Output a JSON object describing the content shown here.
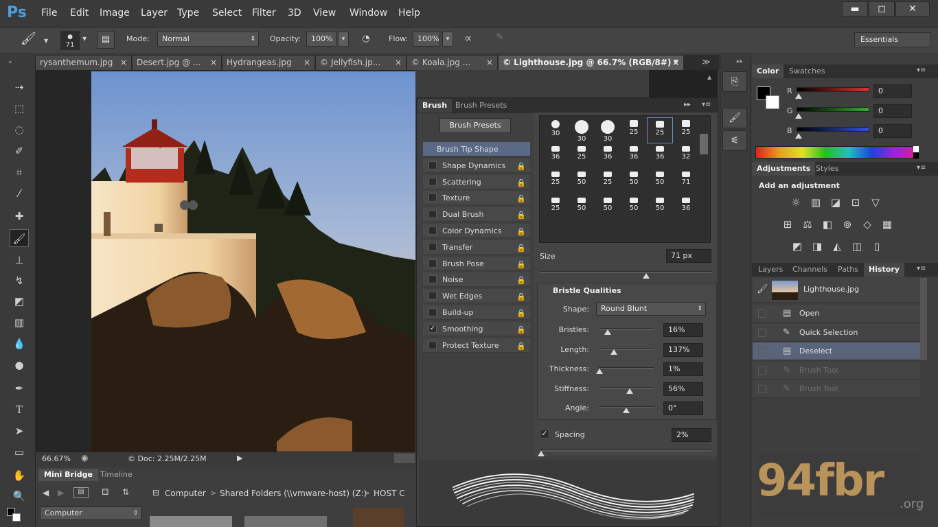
{
  "app": {
    "logo": "Ps"
  },
  "menu": [
    "File",
    "Edit",
    "Image",
    "Layer",
    "Type",
    "Select",
    "Filter",
    "3D",
    "View",
    "Window",
    "Help"
  ],
  "window_controls": {
    "minimize": "▬",
    "maximize": "◻",
    "close": "✕"
  },
  "options_bar": {
    "brush_size": "71",
    "mode_label": "Mode:",
    "mode_value": "Normal",
    "opacity_label": "Opacity:",
    "opacity_value": "100%",
    "flow_label": "Flow:",
    "flow_value": "100%",
    "workspace": "Essentials"
  },
  "doc_tabs": [
    "rysanthemum.jpg",
    "Desert.jpg @ ...",
    "Hydrangeas.jpg",
    "© Jellyfish.jp...",
    "© Koala.jpg ...",
    "© Lighthouse.jpg @ 66.7% (RGB/8#) *"
  ],
  "tab_close": "×",
  "tab_overflow": "≫",
  "status": {
    "zoom": "66.67%",
    "doc": "© Doc: 2.25M/2.25M"
  },
  "bottom_tabs": {
    "mini_bridge": "Mini Bridge",
    "timeline": "Timeline"
  },
  "mini_bridge": {
    "path": [
      "Computer",
      "Shared Folders (\\\\vmware-host) (Z:)",
      "HOST C"
    ],
    "location": "Computer"
  },
  "brush_panel": {
    "tabs": [
      "Brush",
      "Brush Presets"
    ],
    "presets_button": "Brush Presets",
    "options": [
      {
        "label": "Brush Tip Shape",
        "checked": false,
        "selected": true,
        "has_lock": false
      },
      {
        "label": "Shape Dynamics",
        "checked": false,
        "has_lock": true
      },
      {
        "label": "Scattering",
        "checked": false,
        "has_lock": true
      },
      {
        "label": "Texture",
        "checked": false,
        "has_lock": true
      },
      {
        "label": "Dual Brush",
        "checked": false,
        "has_lock": true
      },
      {
        "label": "Color Dynamics",
        "checked": false,
        "has_lock": true
      },
      {
        "label": "Transfer",
        "checked": false,
        "has_lock": true
      },
      {
        "label": "Brush Pose",
        "checked": false,
        "has_lock": true
      },
      {
        "label": "Noise",
        "checked": false,
        "has_lock": true
      },
      {
        "label": "Wet Edges",
        "checked": false,
        "has_lock": true
      },
      {
        "label": "Build-up",
        "checked": false,
        "has_lock": true
      },
      {
        "label": "Smoothing",
        "checked": true,
        "has_lock": true
      },
      {
        "label": "Protect Texture",
        "checked": false,
        "has_lock": true
      }
    ],
    "tip_sizes": [
      [
        "30",
        "30",
        "30",
        "25",
        "25",
        "25"
      ],
      [
        "36",
        "25",
        "36",
        "36",
        "36",
        "32"
      ],
      [
        "25",
        "50",
        "25",
        "50",
        "50",
        "71"
      ],
      [
        "25",
        "50",
        "50",
        "50",
        "50",
        "36"
      ]
    ],
    "size_label": "Size",
    "size_value": "71 px",
    "bristle_title": "Bristle Qualities",
    "shape_label": "Shape:",
    "shape_value": "Round Blunt",
    "params": [
      {
        "label": "Bristles:",
        "value": "16%",
        "fraction": 0.16
      },
      {
        "label": "Length:",
        "value": "137%",
        "fraction": 0.28
      },
      {
        "label": "Thickness:",
        "value": "1%",
        "fraction": 0.01
      },
      {
        "label": "Stiffness:",
        "value": "56%",
        "fraction": 0.56
      },
      {
        "label": "Angle:",
        "value": "0°",
        "fraction": 0.5
      }
    ],
    "spacing_label": "Spacing",
    "spacing_value": "2%"
  },
  "color_panel": {
    "tabs": [
      "Color",
      "Swatches"
    ],
    "channels": [
      {
        "label": "R",
        "value": "0",
        "color": "#e03030"
      },
      {
        "label": "G",
        "value": "0",
        "color": "#30b030"
      },
      {
        "label": "B",
        "value": "0",
        "color": "#3050e0"
      }
    ]
  },
  "adjustments_panel": {
    "tabs": [
      "Adjustments",
      "Styles"
    ],
    "heading": "Add an adjustment",
    "icons": [
      "☼",
      "▥",
      "◪",
      "⊡",
      "▽",
      "⊞",
      "⚖",
      "◧",
      "⊚",
      "◇",
      "▦",
      "◩",
      "◨",
      "◭",
      "◫",
      "▯"
    ]
  },
  "layers_panel": {
    "tabs": [
      "Layers",
      "Channels",
      "Paths",
      "History"
    ],
    "snapshot": "Lighthouse.jpg",
    "history": [
      {
        "label": "Open",
        "state": "normal"
      },
      {
        "label": "Quick Selection",
        "state": "normal"
      },
      {
        "label": "Deselect",
        "state": "selected"
      },
      {
        "label": "Brush Tool",
        "state": "dim"
      },
      {
        "label": "Brush Tool",
        "state": "dim"
      }
    ]
  },
  "watermark": {
    "main": "94fbr",
    "suffix": ".org"
  }
}
